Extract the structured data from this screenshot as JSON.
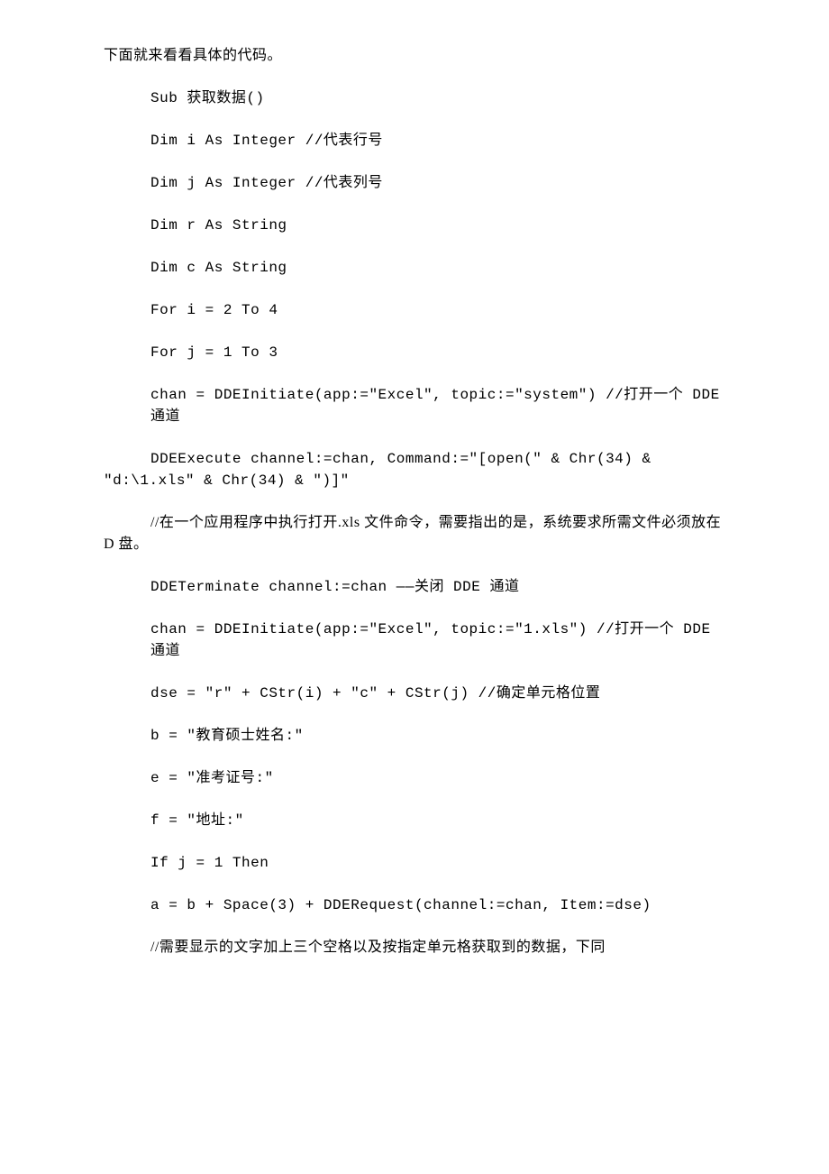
{
  "lines": [
    {
      "text": "下面就来看看具体的代码。",
      "indent": false
    },
    {
      "text": "Sub 获取数据()",
      "indent": true
    },
    {
      "text": "Dim i As Integer //代表行号",
      "indent": true
    },
    {
      "text": "Dim j As Integer //代表列号",
      "indent": true
    },
    {
      "text": "Dim r As String",
      "indent": true
    },
    {
      "text": "Dim c As String",
      "indent": true
    },
    {
      "text": "For i = 2 To 4",
      "indent": true
    },
    {
      "text": "For j = 1 To 3",
      "indent": true
    },
    {
      "text": "chan = DDEInitiate(app:=\"Excel\", topic:=\"system\") //打开一个 DDE 通道",
      "indent": true
    },
    {
      "text": "DDEExecute channel:=chan, Command:=\"[open(\" & Chr(34) & \"d:\\1.xls\" & Chr(34) & \")]\"",
      "indent": true,
      "wrap": true
    },
    {
      "text": "//在一个应用程序中执行打开.xls 文件命令，需要指出的是，系统要求所需文件必须放在 D 盘。",
      "indent": true,
      "wrap": true
    },
    {
      "text": "DDETerminate channel:=chan ——关闭 DDE 通道",
      "indent": true
    },
    {
      "text": "chan = DDEInitiate(app:=\"Excel\", topic:=\"1.xls\") //打开一个 DDE 通道",
      "indent": true
    },
    {
      "text": "dse = \"r\" + CStr(i) + \"c\" + CStr(j) //确定单元格位置",
      "indent": true
    },
    {
      "text": "b = \"教育硕士姓名:\"",
      "indent": true
    },
    {
      "text": "e = \"准考证号:\"",
      "indent": true
    },
    {
      "text": "f = \"地址:\"",
      "indent": true
    },
    {
      "text": "If j = 1 Then",
      "indent": true
    },
    {
      "text": "a = b + Space(3) + DDERequest(channel:=chan, Item:=dse)",
      "indent": true
    },
    {
      "text": "//需要显示的文字加上三个空格以及按指定单元格获取到的数据，下同",
      "indent": true
    }
  ]
}
